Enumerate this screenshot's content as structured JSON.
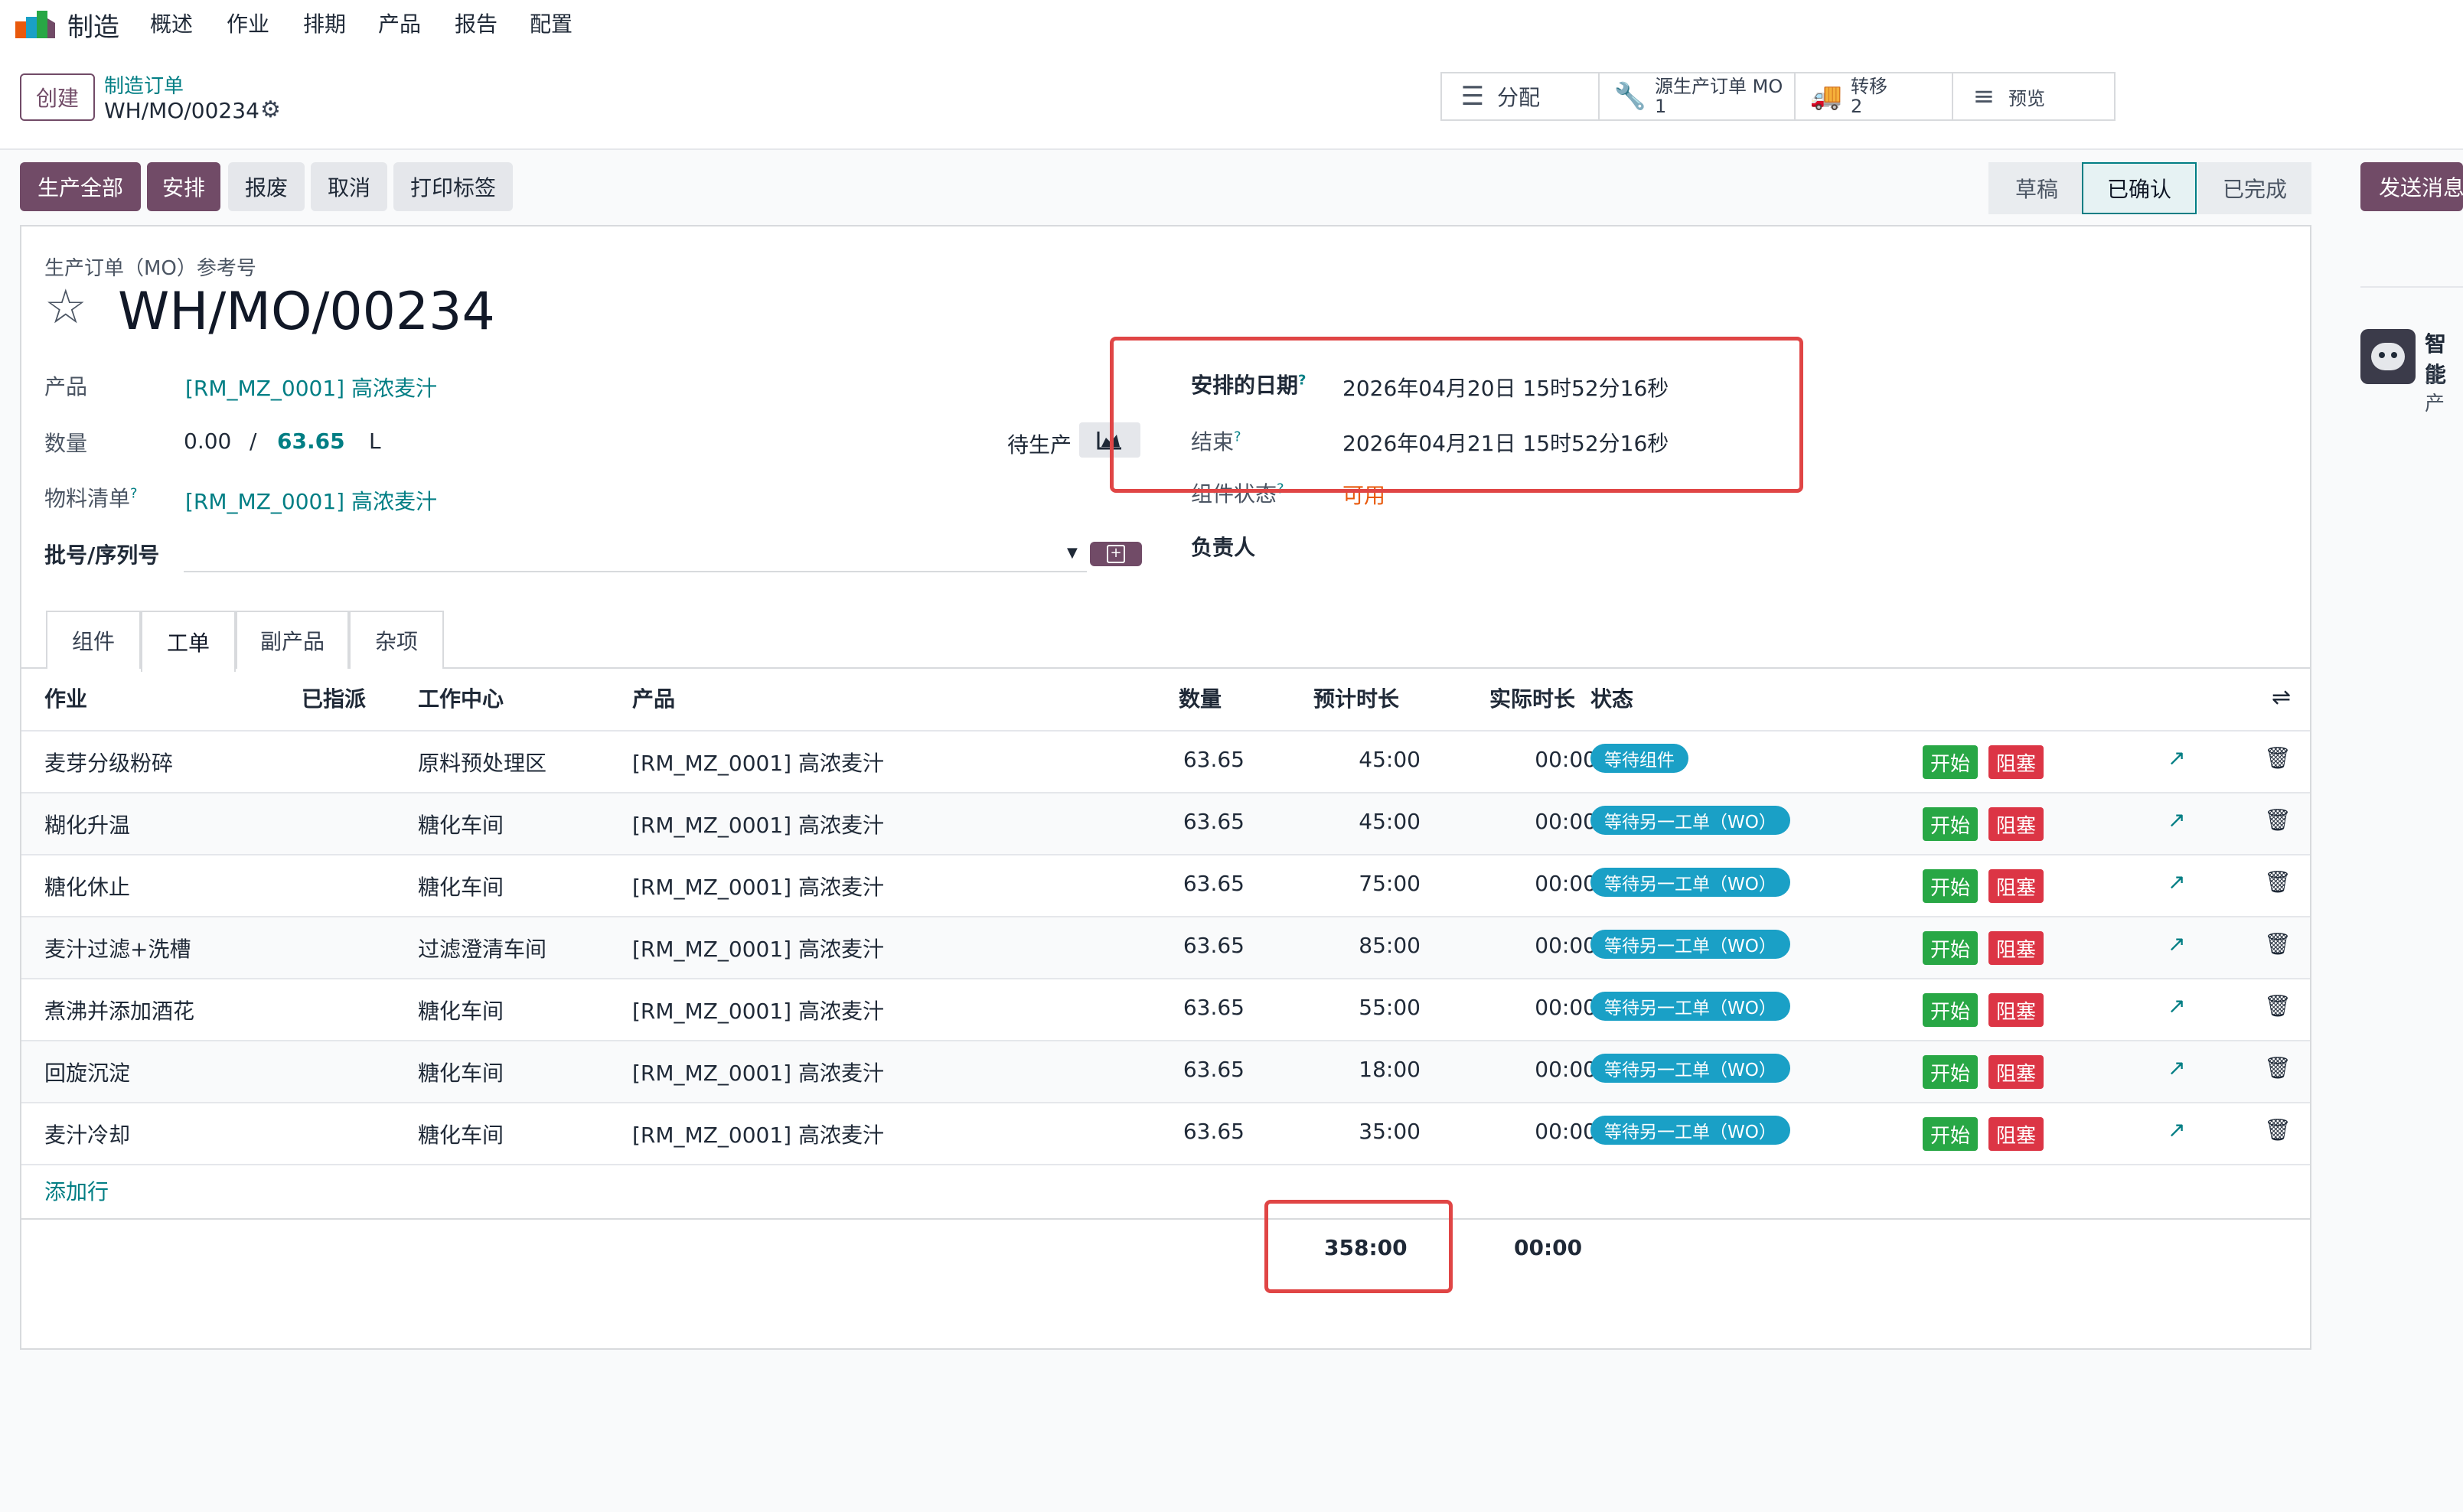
{
  "navbar": {
    "app_name": "制造",
    "menu": [
      "概述",
      "作业",
      "排期",
      "产品",
      "报告",
      "配置"
    ]
  },
  "control": {
    "create_label": "创建",
    "breadcrumb_parent": "制造订单",
    "breadcrumb_current": "WH/MO/00234",
    "smart_buttons": [
      {
        "label": "分配",
        "count": "",
        "icon": "list-icon"
      },
      {
        "label": "源生产订单 MO",
        "count": "1",
        "icon": "wrench-icon"
      },
      {
        "label": "转移",
        "count": "2",
        "icon": "truck-icon"
      },
      {
        "label": "预览",
        "count": "",
        "icon": "menu-icon"
      }
    ]
  },
  "actions": {
    "produce_all": "生产全部",
    "schedule": "安排",
    "scrap": "报废",
    "cancel": "取消",
    "print_labels": "打印标签"
  },
  "statusbar": {
    "stages": [
      "草稿",
      "已确认",
      "已完成"
    ],
    "current": "已确认"
  },
  "chatter": {
    "send_message": "发送消息",
    "bot_name": "智能",
    "bot_sub": "生产"
  },
  "form": {
    "ref_label": "生产订单（MO）参考号",
    "ref": "WH/MO/00234",
    "product_label": "产品",
    "product": "[RM_MZ_0001] 高浓麦汁",
    "qty_label": "数量",
    "qty_produced": "0.00",
    "qty_sep": "/",
    "qty_planned": "63.65",
    "uom": "L",
    "pending_label": "待生产",
    "bom_label": "物料清单",
    "bom": "[RM_MZ_0001] 高浓麦汁",
    "lot_label": "批号/序列号",
    "scheduled_label": "安排的日期",
    "scheduled": "2026年04月20日 15时52分16秒",
    "end_label": "结束",
    "end": "2026年04月21日 15时52分16秒",
    "component_status_label": "组件状态",
    "component_status": "可用",
    "responsible_label": "负责人",
    "help_mark": "?"
  },
  "tabs": [
    "组件",
    "工单",
    "副产品",
    "杂项"
  ],
  "table": {
    "headers": {
      "operation": "作业",
      "assigned": "已指派",
      "workcenter": "工作中心",
      "product": "产品",
      "quantity": "数量",
      "expected": "预计时长",
      "real": "实际时长",
      "status": "状态"
    },
    "rows": [
      {
        "op": "麦芽分级粉碎",
        "wc": "原料预处理区",
        "product": "[RM_MZ_0001] 高浓麦汁",
        "qty": "63.65",
        "expected": "45:00",
        "real": "00:00",
        "status": "等待组件"
      },
      {
        "op": "糊化升温",
        "wc": "糖化车间",
        "product": "[RM_MZ_0001] 高浓麦汁",
        "qty": "63.65",
        "expected": "45:00",
        "real": "00:00",
        "status": "等待另一工单（WO）"
      },
      {
        "op": "糖化休止",
        "wc": "糖化车间",
        "product": "[RM_MZ_0001] 高浓麦汁",
        "qty": "63.65",
        "expected": "75:00",
        "real": "00:00",
        "status": "等待另一工单（WO）"
      },
      {
        "op": "麦汁过滤+洗槽",
        "wc": "过滤澄清车间",
        "product": "[RM_MZ_0001] 高浓麦汁",
        "qty": "63.65",
        "expected": "85:00",
        "real": "00:00",
        "status": "等待另一工单（WO）"
      },
      {
        "op": "煮沸并添加酒花",
        "wc": "糖化车间",
        "product": "[RM_MZ_0001] 高浓麦汁",
        "qty": "63.65",
        "expected": "55:00",
        "real": "00:00",
        "status": "等待另一工单（WO）"
      },
      {
        "op": "回旋沉淀",
        "wc": "糖化车间",
        "product": "[RM_MZ_0001] 高浓麦汁",
        "qty": "63.65",
        "expected": "18:00",
        "real": "00:00",
        "status": "等待另一工单（WO）"
      },
      {
        "op": "麦汁冷却",
        "wc": "糖化车间",
        "product": "[RM_MZ_0001] 高浓麦汁",
        "qty": "63.65",
        "expected": "35:00",
        "real": "00:00",
        "status": "等待另一工单（WO）"
      }
    ],
    "start_label": "开始",
    "block_label": "阻塞",
    "add_line": "添加行",
    "total_expected": "358:00",
    "total_real": "00:00"
  },
  "colors": {
    "brand": "#714b67",
    "link": "#017e84",
    "badge": "#1aa0c6",
    "start": "#28a745",
    "block": "#dc3545",
    "annotation": "#e04545",
    "warning": "#e8590c"
  }
}
